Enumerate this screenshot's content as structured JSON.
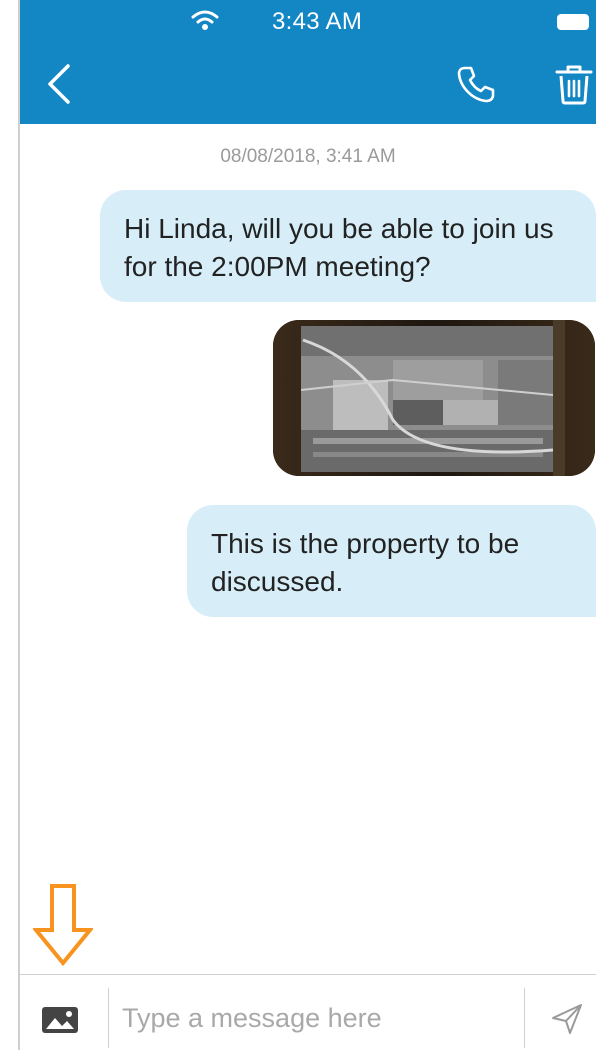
{
  "status_bar": {
    "time": "3:43 AM",
    "wifi_icon": "wifi-icon",
    "battery_icon": "battery-icon"
  },
  "header": {
    "back_icon": "chevron-left-icon",
    "call_icon": "phone-icon",
    "delete_icon": "trash-icon",
    "background_color": "#1386c4"
  },
  "conversation": {
    "timestamp": "08/08/2018, 3:41 AM",
    "messages": [
      {
        "type": "text",
        "direction": "outgoing",
        "text": "Hi Linda, will you be able to join us for the 2:00PM meeting?"
      },
      {
        "type": "image",
        "direction": "outgoing",
        "description_icon": "aerial-photo"
      },
      {
        "type": "text",
        "direction": "outgoing",
        "text": "This is the property to be discussed."
      }
    ],
    "bubble_color": "#d7eef8"
  },
  "annotation": {
    "icon": "arrow-down-icon",
    "color": "#f7931e"
  },
  "composer": {
    "attach_icon": "image-icon",
    "placeholder": "Type a message here",
    "send_icon": "send-icon"
  }
}
